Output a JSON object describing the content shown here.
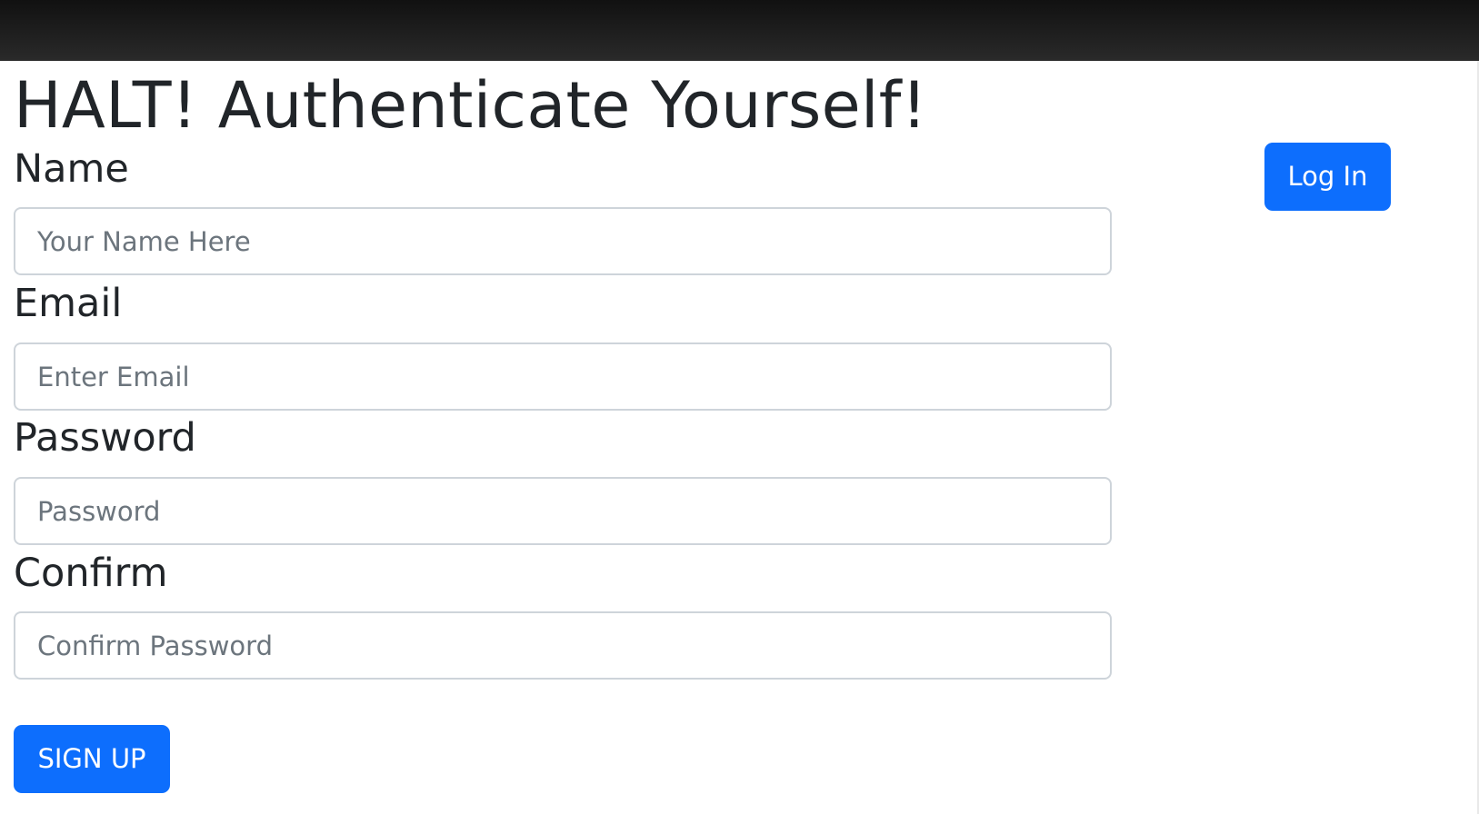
{
  "header": {
    "title": "HALT! Authenticate Yourself!",
    "login_label": "Log In"
  },
  "form": {
    "name": {
      "label": "Name",
      "placeholder": "Your Name Here",
      "value": ""
    },
    "email": {
      "label": "Email",
      "placeholder": "Enter Email",
      "value": ""
    },
    "password": {
      "label": "Password",
      "placeholder": "Password",
      "value": ""
    },
    "confirm": {
      "label": "Confirm",
      "placeholder": "Confirm Password",
      "value": ""
    },
    "submit_label": "SIGN UP"
  },
  "colors": {
    "primary": "#0d6efd",
    "text": "#212529",
    "placeholder": "#6c757d",
    "border": "#ced4da",
    "nav_dark": "#1a1a1a"
  }
}
